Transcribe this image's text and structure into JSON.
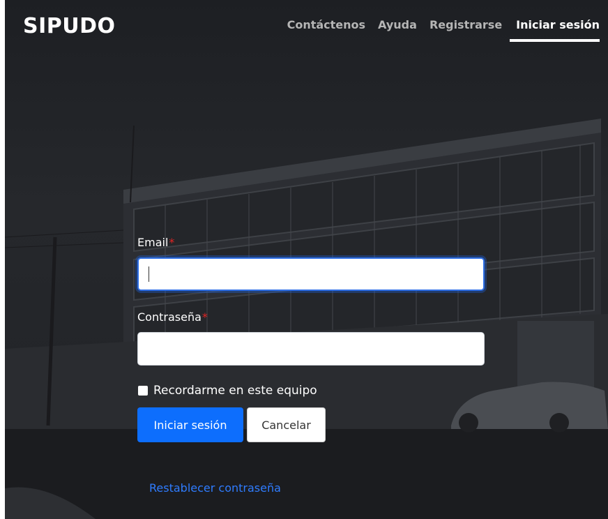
{
  "header": {
    "brand": "SIPUDO",
    "nav": [
      {
        "label": "Contáctenos"
      },
      {
        "label": "Ayuda"
      },
      {
        "label": "Registrarse"
      },
      {
        "label": "Iniciar sesión",
        "active": true
      }
    ]
  },
  "form": {
    "email_label": "Email",
    "email_value": "",
    "password_label": "Contraseña",
    "password_value": "",
    "required_mark": "*",
    "remember_label": "Recordarme en este equipo",
    "remember_checked": false,
    "login_button": "Iniciar sesión",
    "cancel_button": "Cancelar",
    "reset_link": "Restablecer contraseña"
  },
  "colors": {
    "accent": "#0d6efd",
    "required": "#e02424",
    "link": "#2f7cff",
    "background": "#1e2024"
  },
  "icons": {
    "checkbox": "checkbox-unchecked-icon"
  }
}
